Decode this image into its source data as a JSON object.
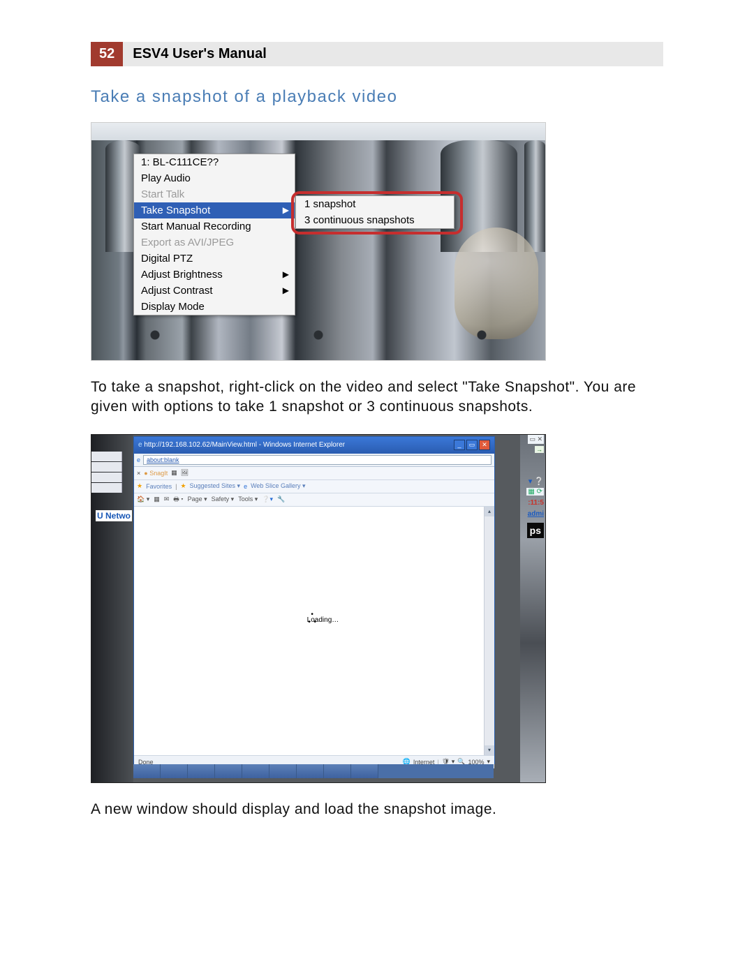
{
  "header": {
    "page_number": "52",
    "manual_title": "ESV4 User's Manual"
  },
  "section_title": "Take a snapshot of a playback video",
  "figure1": {
    "context_menu": {
      "items": [
        {
          "label": "1: BL-C111CE??",
          "disabled": false,
          "submenu": false
        },
        {
          "label": "Play Audio",
          "disabled": false,
          "submenu": false
        },
        {
          "label": "Start Talk",
          "disabled": true,
          "submenu": false
        },
        {
          "label": "Take Snapshot",
          "disabled": false,
          "submenu": true,
          "highlight": true
        },
        {
          "label": "Start Manual Recording",
          "disabled": false,
          "submenu": false
        },
        {
          "label": "Export as AVI/JPEG",
          "disabled": true,
          "submenu": false
        },
        {
          "label": "Digital PTZ",
          "disabled": false,
          "submenu": false
        },
        {
          "label": "Adjust Brightness",
          "disabled": false,
          "submenu": true
        },
        {
          "label": "Adjust Contrast",
          "disabled": false,
          "submenu": true
        },
        {
          "label": "Display Mode",
          "disabled": false,
          "submenu": false
        }
      ]
    },
    "submenu": {
      "items": [
        {
          "label": "1 snapshot"
        },
        {
          "label": "3 continuous snapshots"
        }
      ]
    }
  },
  "paragraph1": "To take a snapshot, right-click on the video and select \"Take Snapshot\". You are given with options to take 1 snapshot or 3 continuous snapshots.",
  "figure2": {
    "browser": {
      "title": "http://192.168.102.62/MainView.html - Windows Internet Explorer",
      "address": "about:blank",
      "tool_x": "×",
      "tool_snag": "SnagIt",
      "fav_label": "Favorites",
      "fav_suggested": "Suggested Sites ▾",
      "fav_gallery": "Web Slice Gallery ▾",
      "cmd_page": "Page ▾",
      "cmd_safety": "Safety ▾",
      "cmd_tools": "Tools ▾",
      "loading_text": "Loading…",
      "status_done": "Done",
      "status_zone": "Internet",
      "status_zoom": "100%",
      "status_protected": "▾"
    },
    "side": {
      "left_label": "U Netwo",
      "right_time": ":11:5",
      "right_admi": "admi",
      "right_ps": "ps",
      "right_qhelp": "▾ ❔"
    }
  },
  "paragraph2": "A new window should display and load the snapshot image."
}
